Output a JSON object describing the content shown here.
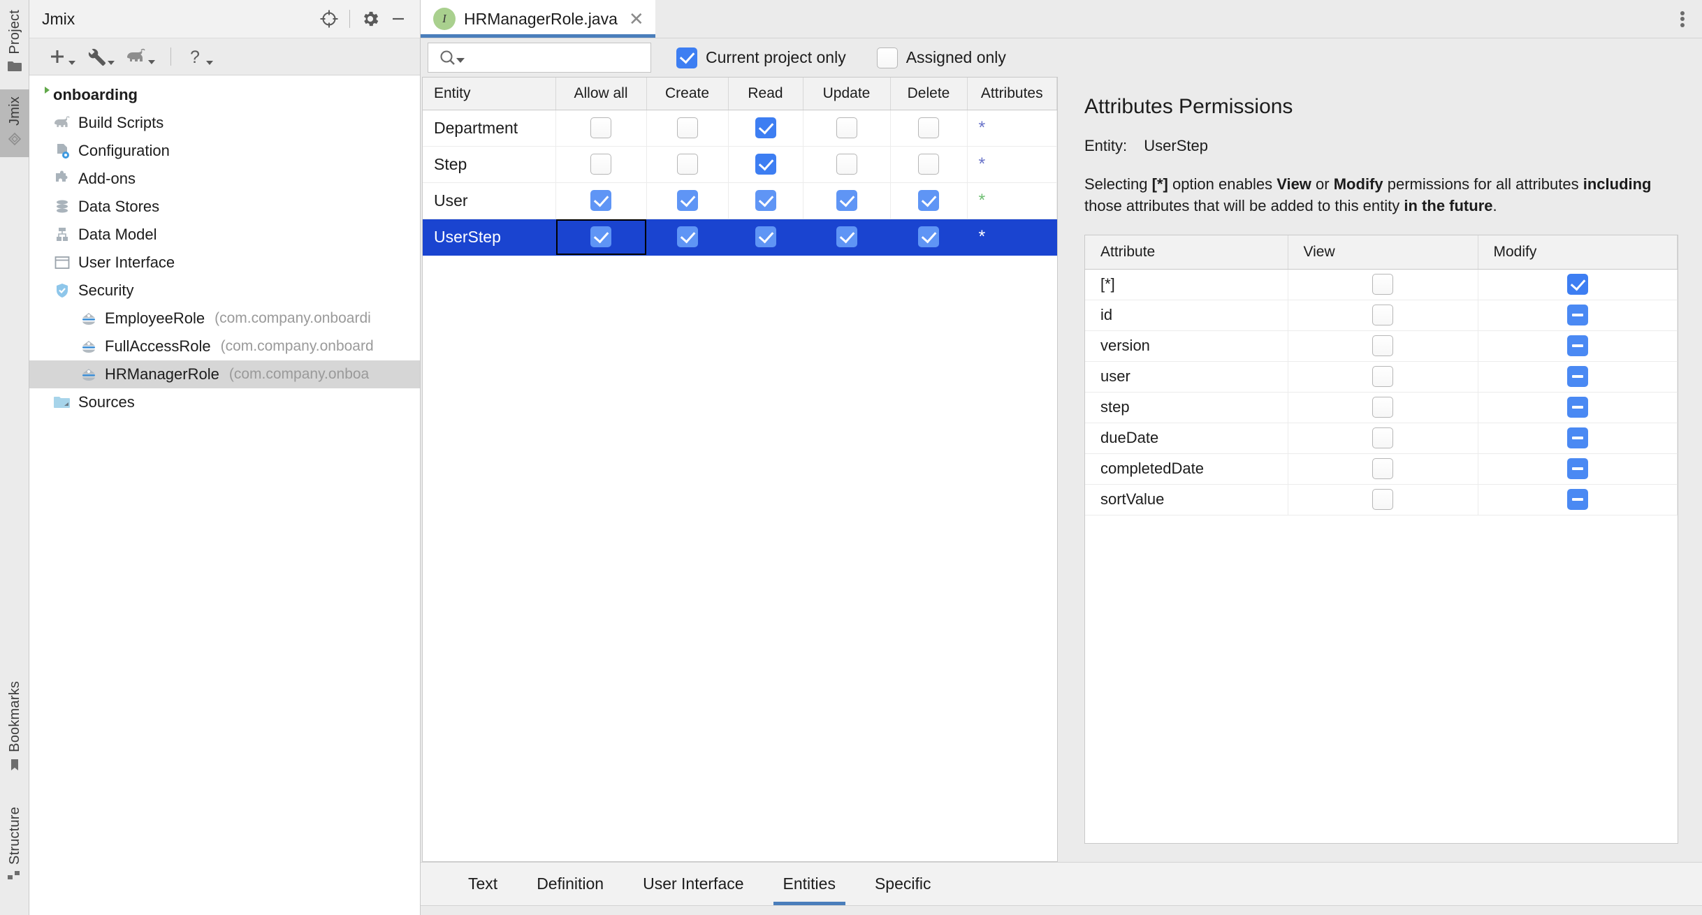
{
  "tool_strip": {
    "tabs": [
      {
        "label": "Project",
        "icon": "folder-icon",
        "selected": false
      },
      {
        "label": "Jmix",
        "icon": "jmix-diamond-icon",
        "selected": true
      },
      {
        "label": "Bookmarks",
        "icon": "bookmark-icon",
        "selected": false
      },
      {
        "label": "Structure",
        "icon": "structure-icon",
        "selected": false
      }
    ]
  },
  "left_panel": {
    "title": "Jmix",
    "header_icons": [
      "locate-target-icon",
      "gear-icon",
      "minimize-icon"
    ],
    "toolbar_icons": [
      "plus-icon",
      "wrench-icon",
      "gradle-elephant-icon",
      "help-question-icon"
    ],
    "tree": [
      {
        "label": "onboarding",
        "icon": "project-root",
        "level": 0,
        "bold": true,
        "selected": false,
        "pkg": ""
      },
      {
        "label": "Build Scripts",
        "icon": "gradle-elephant-icon",
        "level": 1,
        "bold": false,
        "selected": false,
        "pkg": ""
      },
      {
        "label": "Configuration",
        "icon": "configuration-icon",
        "level": 1,
        "bold": false,
        "selected": false,
        "pkg": ""
      },
      {
        "label": "Add-ons",
        "icon": "addons-puzzle-icon",
        "level": 1,
        "bold": false,
        "selected": false,
        "pkg": ""
      },
      {
        "label": "Data Stores",
        "icon": "database-icon",
        "level": 1,
        "bold": false,
        "selected": false,
        "pkg": ""
      },
      {
        "label": "Data Model",
        "icon": "data-model-icon",
        "level": 1,
        "bold": false,
        "selected": false,
        "pkg": ""
      },
      {
        "label": "User Interface",
        "icon": "window-icon",
        "level": 1,
        "bold": false,
        "selected": false,
        "pkg": ""
      },
      {
        "label": "Security",
        "icon": "shield-icon",
        "level": 1,
        "bold": false,
        "selected": false,
        "pkg": ""
      },
      {
        "label": "EmployeeRole",
        "icon": "role-icon",
        "level": 2,
        "bold": false,
        "selected": false,
        "pkg": "(com.company.onboardi"
      },
      {
        "label": "FullAccessRole",
        "icon": "role-icon",
        "level": 2,
        "bold": false,
        "selected": false,
        "pkg": "(com.company.onboard"
      },
      {
        "label": "HRManagerRole",
        "icon": "role-icon",
        "level": 2,
        "bold": false,
        "selected": true,
        "pkg": "(com.company.onboa"
      },
      {
        "label": "Sources",
        "icon": "sources-folder-icon",
        "level": 1,
        "bold": false,
        "selected": false,
        "pkg": ""
      }
    ]
  },
  "editor": {
    "tab": {
      "name": "HRManagerRole.java",
      "badge": "I",
      "badge_color": "#a9d08e",
      "close": "✕"
    },
    "kebab_menu": "more-options",
    "filters": {
      "search_placeholder": "",
      "search_value": "",
      "current_project_only": {
        "label": "Current project only",
        "checked": true
      },
      "assigned_only": {
        "label": "Assigned only",
        "checked": false
      }
    },
    "entities_table": {
      "columns": [
        "Entity",
        "Allow all",
        "Create",
        "Read",
        "Update",
        "Delete",
        "Attributes"
      ],
      "rows": [
        {
          "entity": "Department",
          "allow_all": false,
          "create": false,
          "read": true,
          "update": false,
          "delete": false,
          "attributes": "*",
          "attr_color": "#6a74c9",
          "selected": false
        },
        {
          "entity": "Step",
          "allow_all": false,
          "create": false,
          "read": true,
          "update": false,
          "delete": false,
          "attributes": "*",
          "attr_color": "#6a74c9",
          "selected": false
        },
        {
          "entity": "User",
          "allow_all": true,
          "create": true,
          "read": true,
          "update": true,
          "delete": true,
          "attributes": "*",
          "attr_color": "#6fbf73",
          "selected": false
        },
        {
          "entity": "UserStep",
          "allow_all": true,
          "create": true,
          "read": true,
          "update": true,
          "delete": true,
          "attributes": "*",
          "attr_color": "#ffffff",
          "selected": true
        }
      ]
    },
    "bottom_tabs": [
      {
        "label": "Text",
        "active": false
      },
      {
        "label": "Definition",
        "active": false
      },
      {
        "label": "User Interface",
        "active": false
      },
      {
        "label": "Entities",
        "active": true
      },
      {
        "label": "Specific",
        "active": false
      }
    ]
  },
  "attributes_panel": {
    "title": "Attributes Permissions",
    "entity_label": "Entity:",
    "entity_name": "UserStep",
    "description": {
      "p1": "Selecting ",
      "b1": "[*]",
      "p2": " option enables ",
      "b2": "View",
      "p3": " or ",
      "b3": "Modify",
      "p4": " permissions for all attributes ",
      "b4": "including",
      "p5": " those attributes that will be added to this entity ",
      "b5": "in the future",
      "p6": "."
    },
    "table": {
      "columns": [
        "Attribute",
        "View",
        "Modify"
      ],
      "rows": [
        {
          "attribute": "[*]",
          "view": "unchecked",
          "modify": "checked"
        },
        {
          "attribute": "id",
          "view": "unchecked",
          "modify": "indeterminate"
        },
        {
          "attribute": "version",
          "view": "unchecked",
          "modify": "indeterminate"
        },
        {
          "attribute": "user",
          "view": "unchecked",
          "modify": "indeterminate"
        },
        {
          "attribute": "step",
          "view": "unchecked",
          "modify": "indeterminate"
        },
        {
          "attribute": "dueDate",
          "view": "unchecked",
          "modify": "indeterminate"
        },
        {
          "attribute": "completedDate",
          "view": "unchecked",
          "modify": "indeterminate"
        },
        {
          "attribute": "sortValue",
          "view": "unchecked",
          "modify": "indeterminate"
        }
      ]
    }
  },
  "colors": {
    "accent_blue": "#3d7ef2",
    "selection_blue": "#1a44d0",
    "tab_underline": "#4a7ebb",
    "panel_bg": "#ebebeb"
  }
}
